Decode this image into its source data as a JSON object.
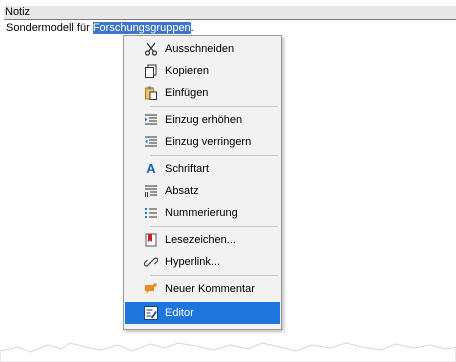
{
  "note": {
    "header": "Notiz",
    "text_before": "Sondermodell für ",
    "text_selected": "Forschungsgruppen",
    "text_after": "."
  },
  "context_menu": {
    "items": [
      {
        "label": "Ausschneiden",
        "icon": "scissors-icon"
      },
      {
        "label": "Kopieren",
        "icon": "copy-icon"
      },
      {
        "label": "Einfügen",
        "icon": "paste-icon"
      },
      {
        "label": "Einzug erhöhen",
        "icon": "indent-increase-icon"
      },
      {
        "label": "Einzug verringern",
        "icon": "indent-decrease-icon"
      },
      {
        "label": "Schriftart",
        "icon": "font-icon"
      },
      {
        "label": "Absatz",
        "icon": "paragraph-icon"
      },
      {
        "label": "Nummerierung",
        "icon": "numbering-icon"
      },
      {
        "label": "Lesezeichen...",
        "icon": "bookmark-icon"
      },
      {
        "label": "Hyperlink...",
        "icon": "hyperlink-icon"
      },
      {
        "label": "Neuer Kommentar",
        "icon": "comment-icon"
      },
      {
        "label": "Editor",
        "icon": "editor-icon",
        "highlighted": true
      }
    ]
  },
  "colors": {
    "selection": "#3f76c5",
    "highlight": "#1e75dc"
  }
}
